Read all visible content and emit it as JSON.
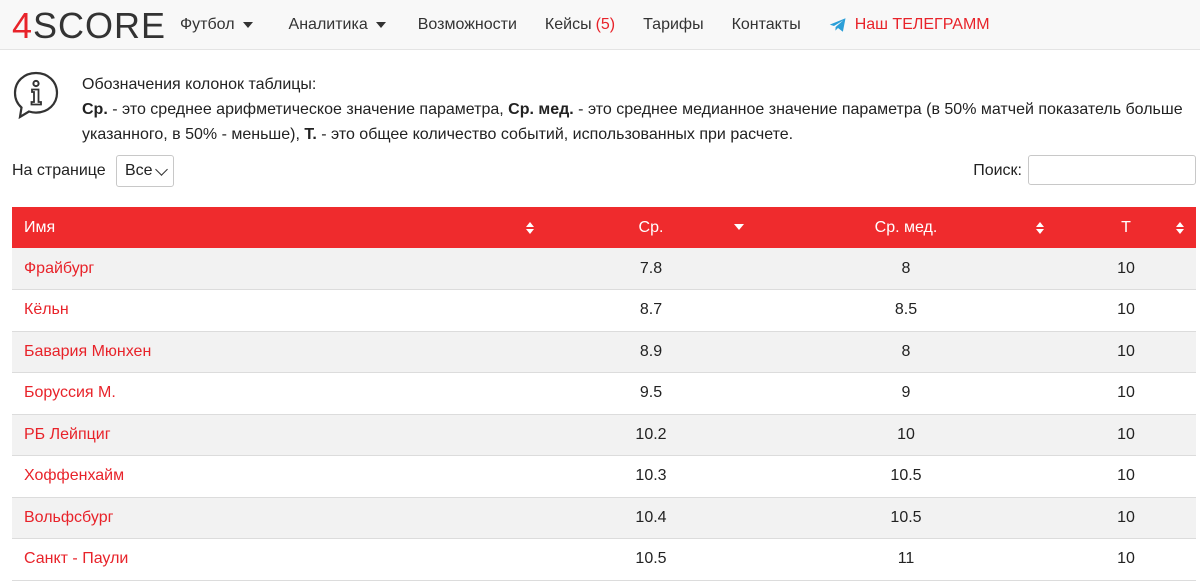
{
  "brand": {
    "logo_digit": "4",
    "logo_text": "SCORE"
  },
  "nav": {
    "football": "Футбол",
    "analytics": "Аналитика",
    "features": "Возможности",
    "cases": "Кейсы",
    "cases_count": "(5)",
    "pricing": "Тарифы",
    "contacts": "Контакты",
    "telegram": "Наш ТЕЛЕГРАММ"
  },
  "info": {
    "title": "Обозначения колонок таблицы:",
    "avg_term": "Ср.",
    "avg_desc": " - это среднее арифметическое значение параметра, ",
    "med_term": "Ср. мед.",
    "med_desc": " - это среднее медианное значение параметра (в 50% матчей показатель больше указанного, в 50% - меньше), ",
    "total_term": "Т.",
    "total_desc": " - это общее количество событий, использованных при расчете."
  },
  "controls": {
    "per_page_label": "На странице",
    "per_page_value": "Все",
    "search_label": "Поиск:",
    "search_value": ""
  },
  "table": {
    "headers": {
      "name": "Имя",
      "avg": "Ср.",
      "median": "Ср. мед.",
      "total": "Т"
    },
    "rows": [
      {
        "name": "Фрайбург",
        "avg": "7.8",
        "median": "8",
        "total": "10"
      },
      {
        "name": "Кёльн",
        "avg": "8.7",
        "median": "8.5",
        "total": "10"
      },
      {
        "name": "Бавария Мюнхен",
        "avg": "8.9",
        "median": "8",
        "total": "10"
      },
      {
        "name": "Боруссия М.",
        "avg": "9.5",
        "median": "9",
        "total": "10"
      },
      {
        "name": "РБ Лейпциг",
        "avg": "10.2",
        "median": "10",
        "total": "10"
      },
      {
        "name": "Хоффенхайм",
        "avg": "10.3",
        "median": "10.5",
        "total": "10"
      },
      {
        "name": "Вольфсбург",
        "avg": "10.4",
        "median": "10.5",
        "total": "10"
      },
      {
        "name": "Санкт - Паули",
        "avg": "10.5",
        "median": "11",
        "total": "10"
      }
    ]
  },
  "colors": {
    "accent": "#ef2b2d",
    "link": "#e8232a"
  },
  "icons": {
    "info": "info-icon",
    "telegram": "telegram-icon",
    "caret": "caret-down-icon",
    "sort": "sort-icon",
    "sort_desc": "sort-desc-icon"
  }
}
